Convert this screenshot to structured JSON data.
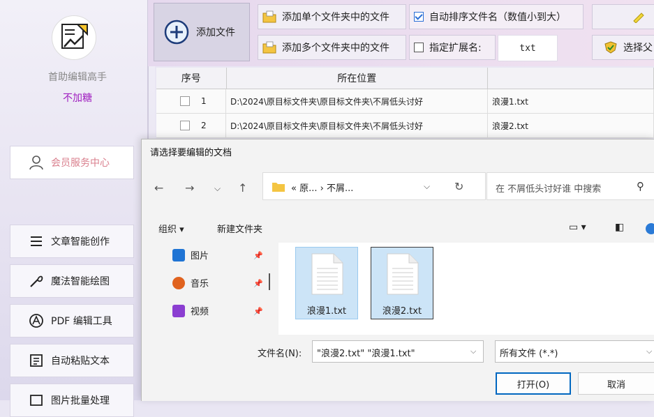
{
  "sidebar": {
    "app_name": "首助编辑高手",
    "app_sub": "不加糖",
    "member_center": "会员服务中心",
    "items": [
      {
        "label": "文章智能创作",
        "icon": "list-icon"
      },
      {
        "label": "魔法智能绘图",
        "icon": "magic-wand-icon"
      },
      {
        "label": "PDF 编辑工具",
        "icon": "pdf-icon"
      },
      {
        "label": "自动粘贴文本",
        "icon": "paste-icon"
      },
      {
        "label": "图片批量处理",
        "icon": "image-icon"
      }
    ]
  },
  "toolbar": {
    "add_file": "添加文件",
    "add_single_folder": "添加单个文件夹中的文件",
    "add_multi_folder": "添加多个文件夹中的文件",
    "auto_sort": "自动排序文件名（数值小到大）",
    "auto_sort_checked": true,
    "specify_ext": "指定扩展名:",
    "specify_ext_checked": false,
    "ext_value": "txt",
    "select_parent": "选择父"
  },
  "table": {
    "headers": [
      "序号",
      "所在位置",
      ""
    ],
    "rows": [
      {
        "index": "1",
        "location": "D:\\2024\\原目标文件夹\\原目标文件夹\\不屑低头讨好",
        "name": "浪漫1.txt"
      },
      {
        "index": "2",
        "location": "D:\\2024\\原目标文件夹\\原目标文件夹\\不屑低头讨好",
        "name": "浪漫2.txt"
      }
    ]
  },
  "dialog": {
    "title": "请选择要编辑的文档",
    "path": "« 原... › 不屑...",
    "search_placeholder": "在 不屑低头讨好谁 中搜索",
    "organize": "组织 ▾",
    "new_folder": "新建文件夹",
    "nav_items": [
      {
        "label": "图片",
        "color": "#1f74d4"
      },
      {
        "label": "音乐",
        "color": "#e0621e"
      },
      {
        "label": "视频",
        "color": "#8b3ed1"
      }
    ],
    "files": [
      {
        "name": "浪漫1.txt"
      },
      {
        "name": "浪漫2.txt"
      }
    ],
    "filename_label": "文件名(N):",
    "filename_value": "\"浪漫2.txt\" \"浪漫1.txt\"",
    "filter_value": "所有文件 (*.*)",
    "open_label": "打开(O)",
    "cancel_label": "取消"
  }
}
